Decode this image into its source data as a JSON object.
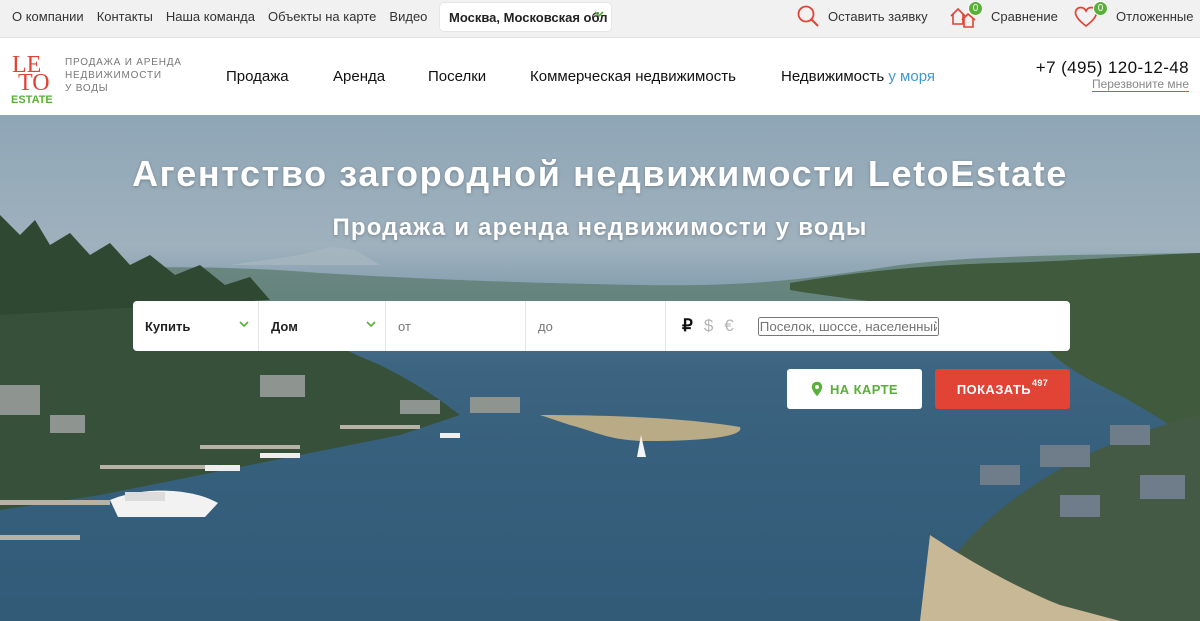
{
  "topbar": {
    "links": [
      "О компании",
      "Контакты",
      "Наша команда",
      "Объекты на карте",
      "Видео"
    ],
    "region": "Москва, Московская обл",
    "request_label": "Оставить заявку",
    "compare_label": "Сравнение",
    "compare_count": "0",
    "saved_label": "Отложенные",
    "saved_count": "0"
  },
  "header": {
    "logo_letters": [
      "LE",
      "TO",
      "ESTATE"
    ],
    "tagline": [
      "ПРОДАЖА И АРЕНДА",
      "НЕДВИЖИМОСТИ",
      "У ВОДЫ"
    ],
    "nav": [
      "Продажа",
      "Аренда",
      "Поселки",
      "Коммерческая недвижимость"
    ],
    "nav_last": "Недвижимость",
    "nav_last_accent": "у моря",
    "phone": "+7 (495) 120-12-48",
    "callback": "Перезвоните мне"
  },
  "hero": {
    "title": "Агентство загородной недвижимости LetoEstate",
    "subtitle": "Продажа и аренда недвижимости у воды"
  },
  "search": {
    "deal_type": "Купить",
    "property_type": "Дом",
    "price_from_placeholder": "от",
    "price_to_placeholder": "до",
    "currencies": [
      "₽",
      "$",
      "€"
    ],
    "active_currency": "₽",
    "location_placeholder": "Поселок, шоссе, населенный пункт или ID",
    "map_button": "НА КАРТЕ",
    "show_button": "ПОКАЗАТЬ",
    "result_count": "497"
  },
  "colors": {
    "brand_red": "#e14334",
    "brand_green": "#58b038",
    "accent_blue": "#3d9ad1"
  },
  "icons": [
    "search-icon",
    "houses-icon",
    "heart-icon",
    "chevron-down-icon",
    "map-pin-icon"
  ]
}
